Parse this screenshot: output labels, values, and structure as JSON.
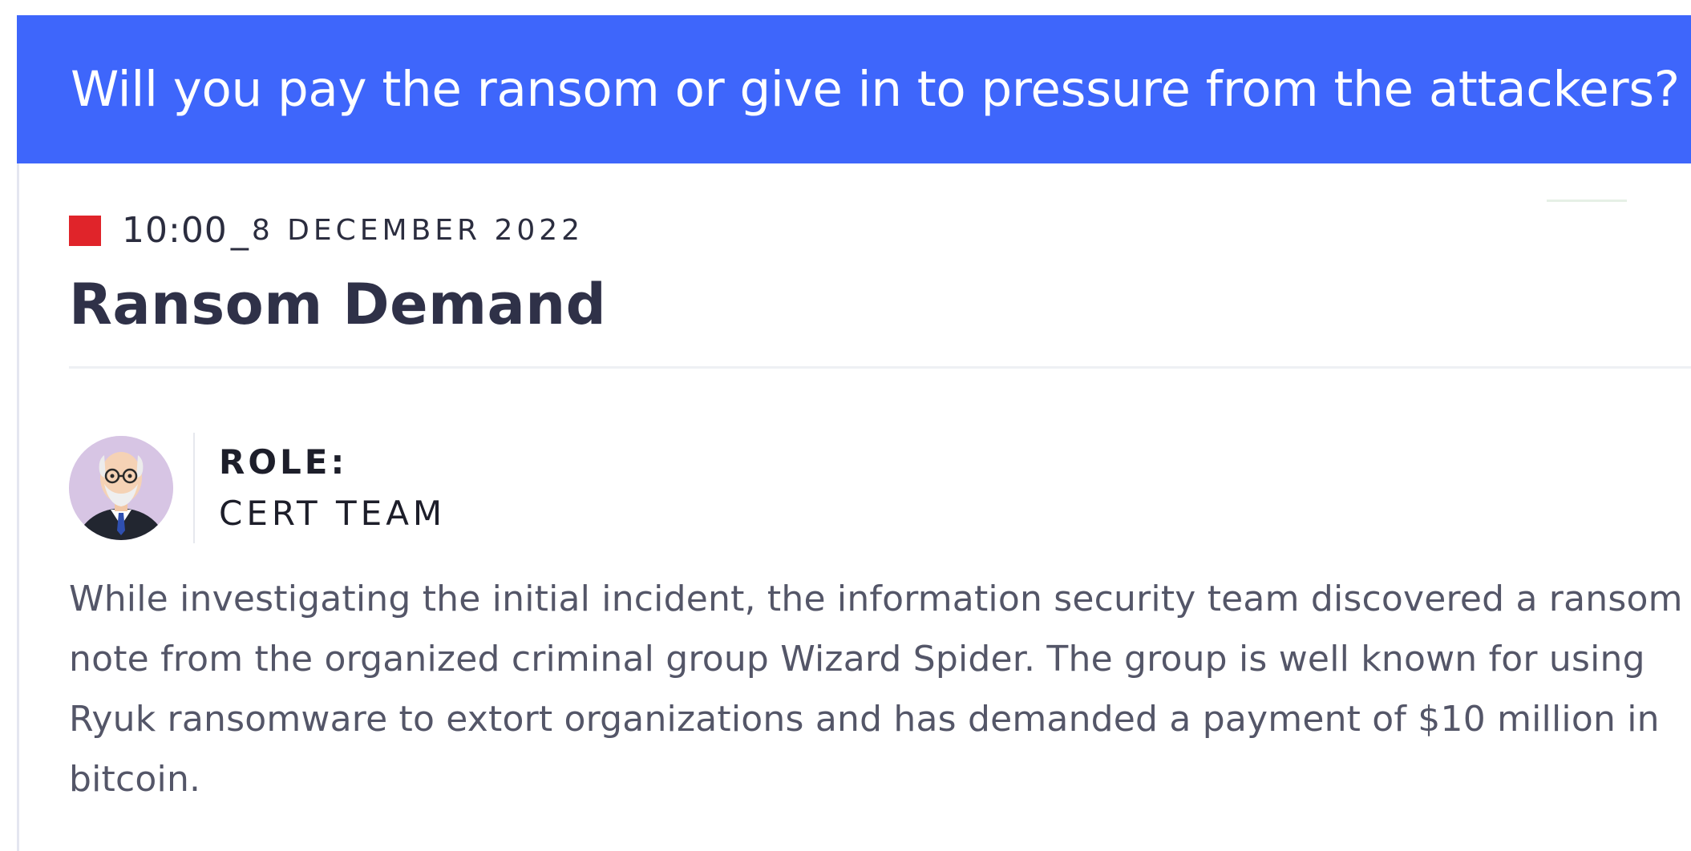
{
  "banner": {
    "question": "Will you pay the ransom or give in to pressure from the attackers?"
  },
  "card": {
    "time": "10:00",
    "separator": "_",
    "date": "8 DECEMBER 2022",
    "status_color": "#e0242a",
    "title": "Ransom Demand",
    "role": {
      "label": "ROLE:",
      "value": "CERT TEAM",
      "avatar_icon": "elderly-man-avatar-icon"
    },
    "body": "While investigating the initial incident, the information security team discovered a ransom note from the organized criminal group Wizard Spider. The group is well known for using Ryuk ransomware to extort organizations and has demanded a payment of $10 million in bitcoin."
  },
  "colors": {
    "banner_bg": "#3e66fb",
    "banner_text": "#ffffff",
    "title_text": "#2f3148",
    "body_text": "#545668"
  }
}
